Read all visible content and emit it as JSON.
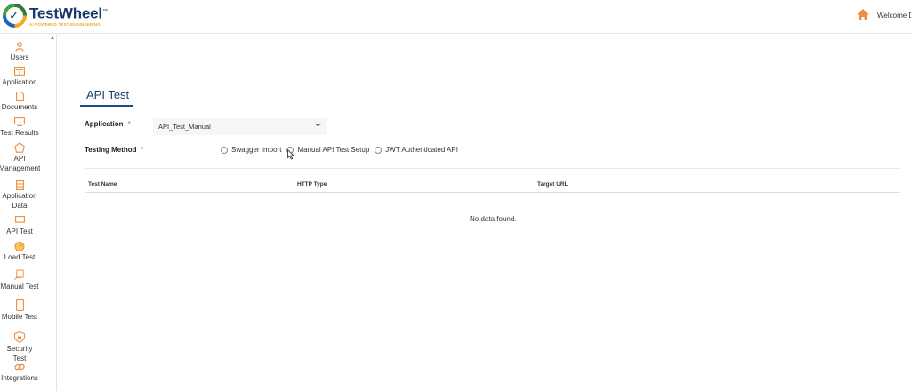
{
  "header": {
    "logo_name": "TestWheel",
    "logo_tm": "™",
    "logo_tagline": "AI POWERED TEST ENGINEERING",
    "welcome_text": "Welcome Dil",
    "icons": [
      "home-icon"
    ]
  },
  "sidebar": {
    "items": [
      {
        "label": "Users",
        "icon": "user-icon"
      },
      {
        "label": "Application",
        "icon": "application-icon"
      },
      {
        "label": "Documents",
        "icon": "document-icon"
      },
      {
        "label": "Test Results",
        "icon": "test-results-icon"
      },
      {
        "label": "API Management",
        "icon": "api-management-icon"
      },
      {
        "label": "Application Data",
        "icon": "application-data-icon"
      },
      {
        "label": "API Test",
        "icon": "api-test-icon"
      },
      {
        "label": "Load Test",
        "icon": "load-test-icon"
      },
      {
        "label": "Manual Test",
        "icon": "manual-test-icon"
      },
      {
        "label": "Mobile Test",
        "icon": "mobile-test-icon"
      },
      {
        "label": "Security Test",
        "icon": "security-test-icon"
      },
      {
        "label": "Integrations",
        "icon": "integrations-icon"
      }
    ]
  },
  "main": {
    "title": "API Test",
    "application_label": "Application",
    "required_mark": "*",
    "application_value": "API_Test_Manual",
    "testing_method_label": "Testing Method",
    "testing_methods": [
      "Swagger Import",
      "Manual API Test Setup",
      "JWT Authenticated API"
    ],
    "table": {
      "columns": [
        "Test Name",
        "HTTP Type",
        "Target URL"
      ],
      "empty_message": "No data found."
    }
  },
  "colors": {
    "accent": "#1a4e8a",
    "icon_orange": "#f08c3a",
    "required": "#d9534f"
  }
}
